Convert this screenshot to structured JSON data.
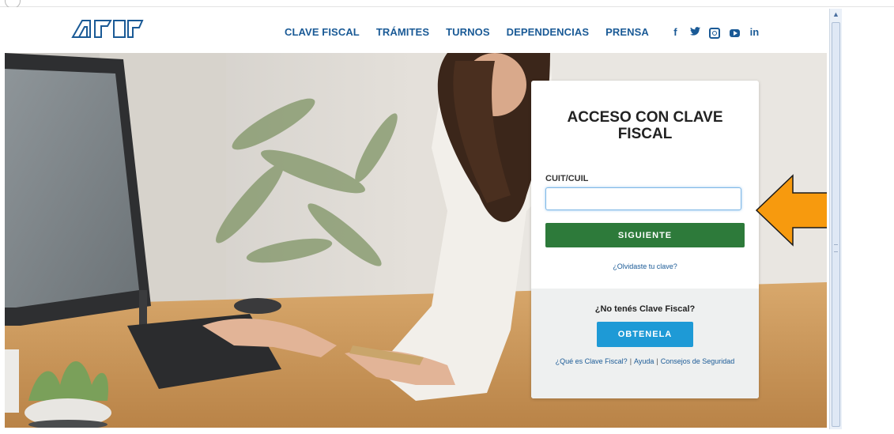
{
  "header": {
    "nav": [
      "CLAVE FISCAL",
      "TRÁMITES",
      "TURNOS",
      "DEPENDENCIAS",
      "PRENSA"
    ],
    "social": [
      "facebook-icon",
      "twitter-icon",
      "instagram-icon",
      "youtube-icon",
      "linkedin-icon"
    ],
    "social_text": {
      "facebook": "f",
      "linkedin": "in"
    }
  },
  "login": {
    "title": "ACCESO CON CLAVE FISCAL",
    "cuit_label": "CUIT/CUIL",
    "cuit_value": "",
    "next_button": "SIGUIENTE",
    "forgot_link": "¿Olvidaste tu clave?",
    "no_clave_text": "¿No tenés Clave Fiscal?",
    "get_button": "OBTENELA",
    "help_links": {
      "what_is": "¿Qué es Clave Fiscal?",
      "sep": "|",
      "help": "Ayuda",
      "security": "Consejos de Seguridad"
    }
  },
  "colors": {
    "brand_blue": "#1a5a96",
    "next_green": "#2d7a3a",
    "get_blue": "#1e9ad6",
    "arrow_orange": "#f79a0e"
  }
}
